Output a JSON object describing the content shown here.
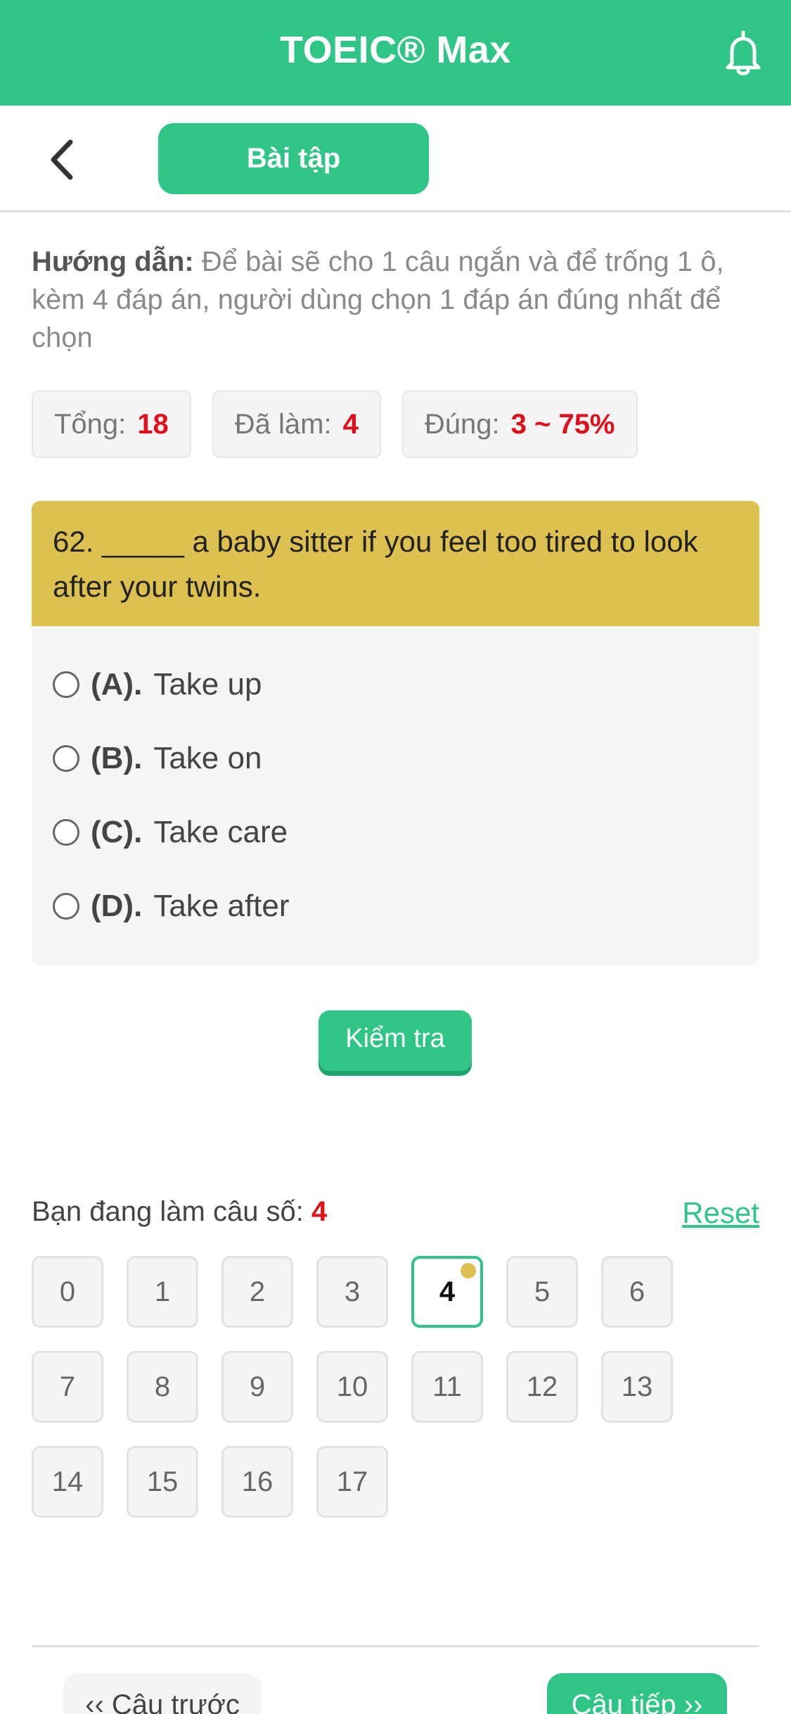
{
  "header": {
    "title": "TOEIC® Max",
    "bell_icon": "bell-icon"
  },
  "subnav": {
    "back_icon": "chevron-left-icon",
    "tab_label": "Bài tập"
  },
  "instruction": {
    "label": "Hướng dẫn:",
    "text": " Để bài sẽ cho 1 câu ngắn và để trống 1 ô, kèm 4 đáp án, người dùng chọn 1 đáp án đúng nhất để chọn"
  },
  "stats": [
    {
      "label": "Tổng:",
      "value": "18"
    },
    {
      "label": "Đã làm:",
      "value": "4"
    },
    {
      "label": "Đúng:",
      "value": "3 ~ 75%"
    }
  ],
  "question": {
    "text": "62. _____ a baby sitter if you feel too tired to look after your twins.",
    "options": [
      {
        "letter": "(A).",
        "text": "Take up"
      },
      {
        "letter": "(B).",
        "text": "Take on"
      },
      {
        "letter": "(C).",
        "text": "Take care"
      },
      {
        "letter": "(D).",
        "text": "Take after"
      }
    ]
  },
  "check_label": "Kiểm tra",
  "progress": {
    "current_label": "Bạn đang làm câu số:",
    "current_number": "4",
    "reset_label": "Reset",
    "numbers": [
      "0",
      "1",
      "2",
      "3",
      "4",
      "5",
      "6",
      "7",
      "8",
      "9",
      "10",
      "11",
      "12",
      "13",
      "14",
      "15",
      "16",
      "17"
    ],
    "active_index": 4
  },
  "nav": {
    "prev_label": "‹‹ Câu trước",
    "next_label": "Câu tiếp ››"
  },
  "colors": {
    "primary": "#2ec586",
    "question_bg": "#dcc050",
    "highlight": "#e0101b"
  }
}
